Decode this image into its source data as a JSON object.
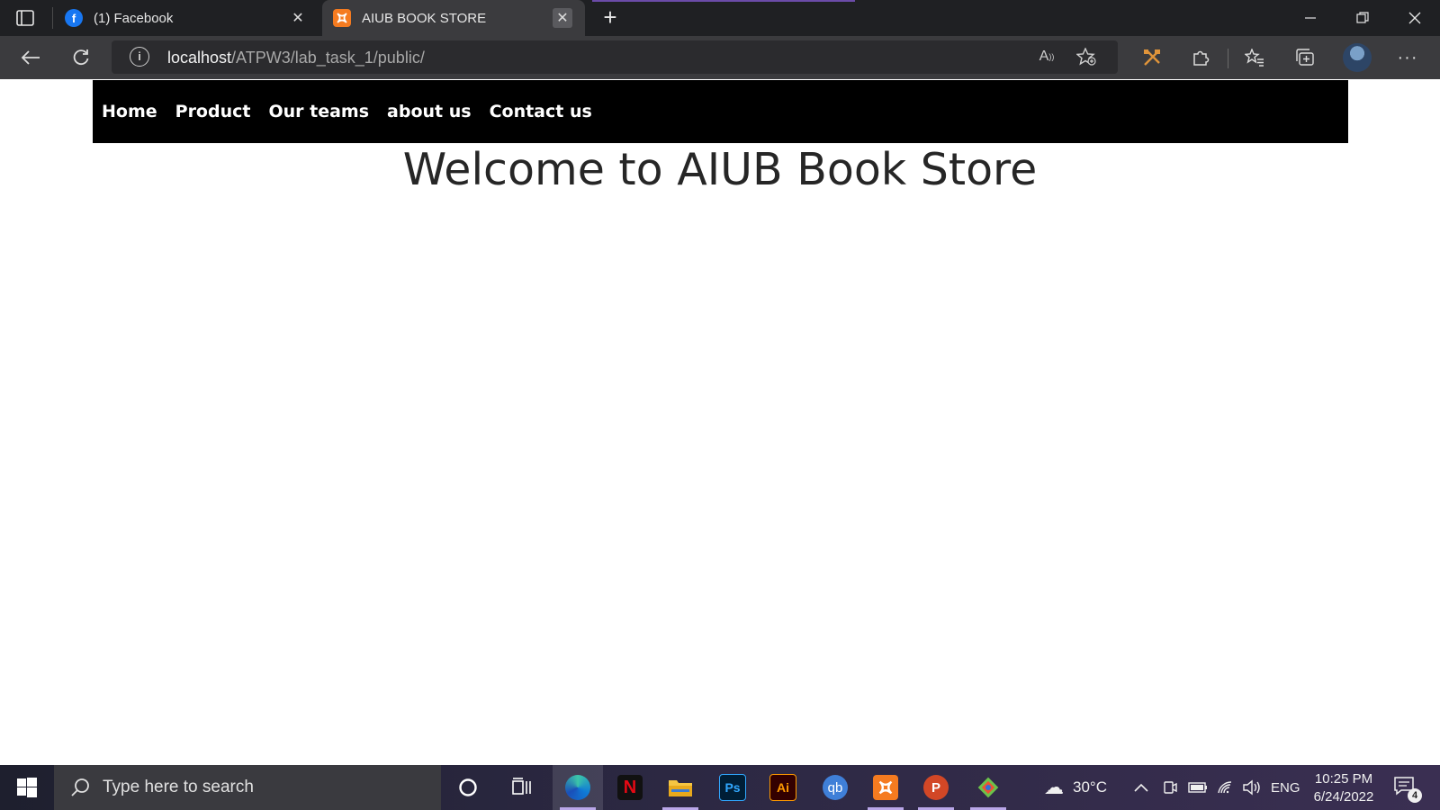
{
  "browser": {
    "tabs": [
      {
        "title": "(1) Facebook",
        "icon": "facebook-icon",
        "active": false
      },
      {
        "title": "AIUB BOOK STORE",
        "icon": "xampp-icon",
        "active": true
      }
    ],
    "address": {
      "host": "localhost",
      "path": "/ATPW3/lab_task_1/public/"
    }
  },
  "page": {
    "nav": [
      "Home",
      "Product",
      "Our teams",
      "about us",
      "Contact us"
    ],
    "heading": "Welcome to AIUB Book Store"
  },
  "taskbar": {
    "search_placeholder": "Type here to search",
    "apps": [
      "cortana-icon",
      "task-view-icon",
      "edge-icon",
      "netflix-icon",
      "file-explorer-icon",
      "photoshop-icon",
      "illustrator-icon",
      "qbittorrent-icon",
      "xampp-icon",
      "powerpoint-icon",
      "git-icon"
    ],
    "app_labels": {
      "netflix": "N",
      "photoshop": "Ps",
      "illustrator": "Ai",
      "qbittorrent": "qb"
    },
    "weather": "30°C",
    "language": "ENG",
    "time": "10:25 PM",
    "date": "6/24/2022",
    "notification_count": "4"
  },
  "colors": {
    "navbar_bg": "#000000",
    "heading_text": "#262626",
    "tab_strip": "#1f2023",
    "toolbar": "#3b3b3e"
  }
}
